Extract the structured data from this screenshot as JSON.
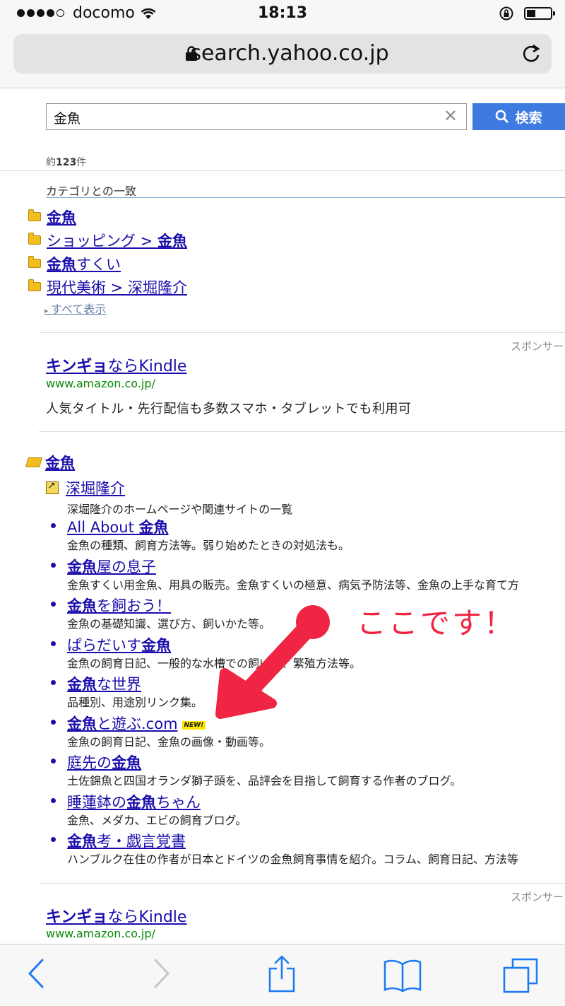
{
  "status": {
    "carrier": "docomo",
    "time": "18:13"
  },
  "browser": {
    "url": "search.yahoo.co.jp"
  },
  "search": {
    "query": "金魚",
    "button": "検索"
  },
  "result_count": {
    "prefix": "約",
    "number": "123",
    "suffix": "件"
  },
  "category": {
    "title": "カテゴリとの一致",
    "items": [
      {
        "a": "",
        "b": "金魚"
      },
      {
        "a": "ショッピング > ",
        "b": "金魚"
      },
      {
        "a": "",
        "b": "金魚",
        "c": "すくい"
      },
      {
        "a": "現代美術 > 深堀隆介",
        "b": ""
      }
    ],
    "show_all": "すべて表示"
  },
  "ads": [
    {
      "sponsor": "スポンサー",
      "title_bold": "キンギョ",
      "title_rest": "ならKindle",
      "url": "www.amazon.co.jp/",
      "desc": "人気タイトル・先行配信も多数スマホ・タブレットでも利用可"
    },
    {
      "sponsor": "スポンサー",
      "title_bold": "キンギョ",
      "title_rest": "ならKindle",
      "url": "www.amazon.co.jp/"
    }
  ],
  "section": {
    "title": "金魚",
    "sub_title": "深堀隆介",
    "sub_desc": "深堀隆介のホームページや関連サイトの一覧",
    "results": [
      {
        "t1": "All About ",
        "t2": "金魚",
        "t3": "",
        "desc": "金魚の種類、飼育方法等。弱り始めたときの対処法も。"
      },
      {
        "t1": "",
        "t2": "金魚",
        "t3": "屋の息子",
        "desc": "金魚すくい用金魚、用具の販売。金魚すくいの極意、病気予防法等、金魚の上手な育て方"
      },
      {
        "t1": "",
        "t2": "金魚",
        "t3": "を飼おう！",
        "desc": "金魚の基礎知識、選び方、飼いかた等。"
      },
      {
        "t1": "ぱらだいす",
        "t2": "金魚",
        "t3": "",
        "desc": "金魚の飼育日記、一般的な水槽での飼い方、繁殖方法等。"
      },
      {
        "t1": "",
        "t2": "金魚",
        "t3": "な世界",
        "desc": "品種別、用途別リンク集。"
      },
      {
        "t1": "",
        "t2": "金魚",
        "t3": "と遊ぶ.com",
        "desc": "金魚の飼育日記、金魚の画像・動画等。",
        "badge": "NEW!"
      },
      {
        "t1": "庭先の",
        "t2": "金魚",
        "t3": "",
        "desc": "土佐錦魚と四国オランダ獅子頭を、品評会を目指して飼育する作者のブログ。"
      },
      {
        "t1": "睡蓮鉢の",
        "t2": "金魚",
        "t3": "ちゃん",
        "desc": "金魚、メダカ、エビの飼育ブログ。"
      },
      {
        "t1": "",
        "t2": "金魚",
        "t3": "考・戯言覚書",
        "desc": "ハンブルク在住の作者が日本とドイツの金魚飼育事情を紹介。コラム、飼育日記、方法等"
      }
    ]
  },
  "annotation": "ここです！",
  "colors": {
    "link": "#1a0dab",
    "url_green": "#0a8a0a",
    "search_button": "#3d7be0",
    "annotation": "#ef2543",
    "ios_blue": "#1f7bf2"
  },
  "icons": [
    "lock-icon",
    "reload-icon",
    "search-icon",
    "clear-icon",
    "folder-icon",
    "back-icon",
    "forward-icon",
    "share-icon",
    "bookmarks-icon",
    "tabs-icon"
  ]
}
